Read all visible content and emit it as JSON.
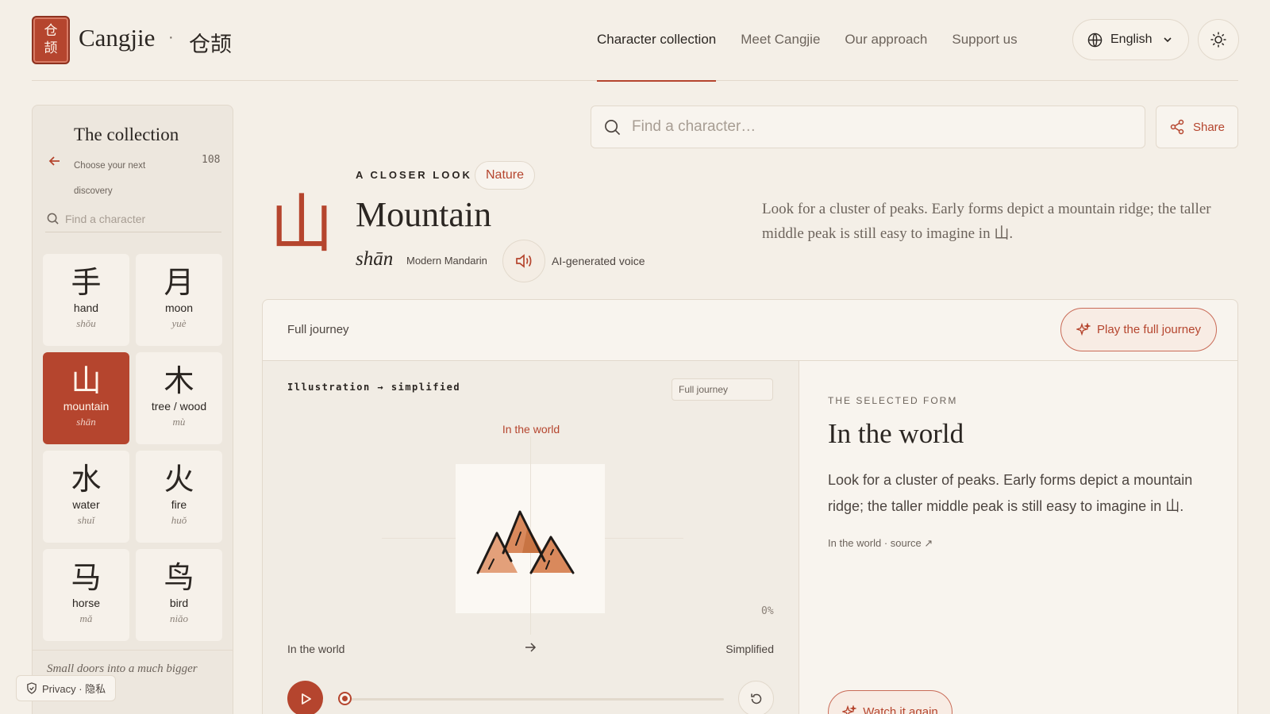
{
  "header": {
    "logo_chars": [
      "仓",
      "颉"
    ],
    "brand": "Cangjie",
    "brand_dot": "·",
    "brand_zh": "仓颉",
    "nav": [
      "Character collection",
      "Meet Cangjie",
      "Our approach",
      "Support us"
    ],
    "nav_active": 0,
    "language": "English"
  },
  "sidebar": {
    "title": "The collection",
    "subtitle": "Choose your next discovery",
    "count": "108",
    "search_placeholder": "Find a character",
    "tiles": [
      {
        "char": "手",
        "en": "hand",
        "pinyin": "shǒu"
      },
      {
        "char": "月",
        "en": "moon",
        "pinyin": "yuè"
      },
      {
        "char": "山",
        "en": "mountain",
        "pinyin": "shān"
      },
      {
        "char": "木",
        "en": "tree / wood",
        "pinyin": "mù"
      },
      {
        "char": "水",
        "en": "water",
        "pinyin": "shuǐ"
      },
      {
        "char": "火",
        "en": "fire",
        "pinyin": "huǒ"
      },
      {
        "char": "马",
        "en": "horse",
        "pinyin": "mǎ"
      },
      {
        "char": "鸟",
        "en": "bird",
        "pinyin": "niǎo"
      }
    ],
    "selected_index": 2,
    "tagline": "Small doors into a much bigger"
  },
  "privacy": "Privacy · 隐私",
  "search": {
    "placeholder": "Find a character…"
  },
  "share_label": "Share",
  "character": {
    "glyph": "山",
    "eyebrow": "A CLOSER LOOK",
    "tag": "Nature",
    "title": "Mountain",
    "pinyin": "shān",
    "pinyin_label": "Modern Mandarin",
    "voice_label": "AI-generated voice",
    "description": "Look for a cluster of peaks. Early forms depict a mountain ridge; the taller middle peak is still easy to imagine in 山."
  },
  "journey": {
    "label": "Full journey",
    "play_full_label": "Play the full journey",
    "stage_title": "Illustration → simplified",
    "stage_pill": "Full journey",
    "stage_caption": "In the world",
    "progress_text": "0%",
    "progress": 0,
    "from_label": "In the world",
    "to_label": "Simplified"
  },
  "selected_form": {
    "eyebrow": "THE SELECTED FORM",
    "title": "In the world",
    "text": "Look for a cluster of peaks. Early forms depict a mountain ridge; the taller middle peak is still easy to imagine in 山.",
    "source": "In the world · source ↗",
    "watch_label": "Watch it again"
  },
  "colors": {
    "accent": "#b5452e",
    "background": "#f4efe7",
    "panel": "#f8f4ee"
  }
}
